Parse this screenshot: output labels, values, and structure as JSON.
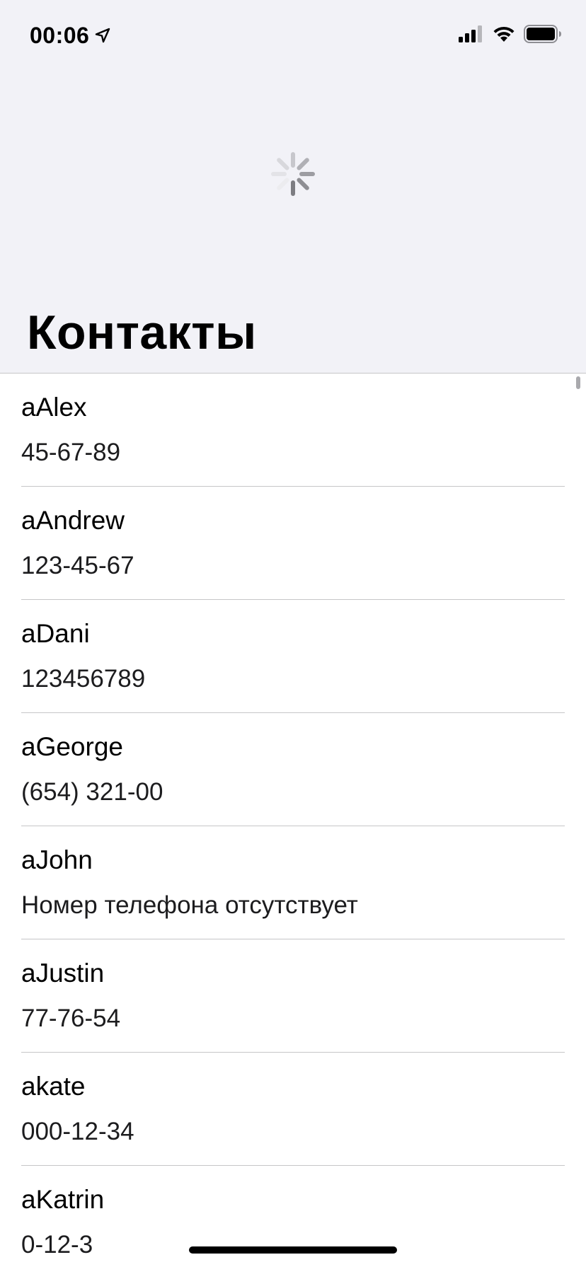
{
  "status_bar": {
    "time": "00:06",
    "location_icon": "location-arrow-icon",
    "signal_icon": "cellular-signal-icon",
    "wifi_icon": "wifi-icon",
    "battery_icon": "battery-icon"
  },
  "header": {
    "title": "Контакты",
    "loading_icon": "activity-spinner-icon",
    "background_color": "#f2f2f7"
  },
  "contacts": [
    {
      "name": "aAlex",
      "phone": "45-67-89"
    },
    {
      "name": "aAndrew",
      "phone": "123-45-67"
    },
    {
      "name": "aDani",
      "phone": "123456789"
    },
    {
      "name": "aGeorge",
      "phone": "(654) 321-00"
    },
    {
      "name": "aJohn",
      "phone": "Номер телефона отсутствует"
    },
    {
      "name": "aJustin",
      "phone": "77-76-54"
    },
    {
      "name": "akate",
      "phone": "000-12-34"
    },
    {
      "name": "aKatrin",
      "phone": "0-12-3"
    }
  ]
}
